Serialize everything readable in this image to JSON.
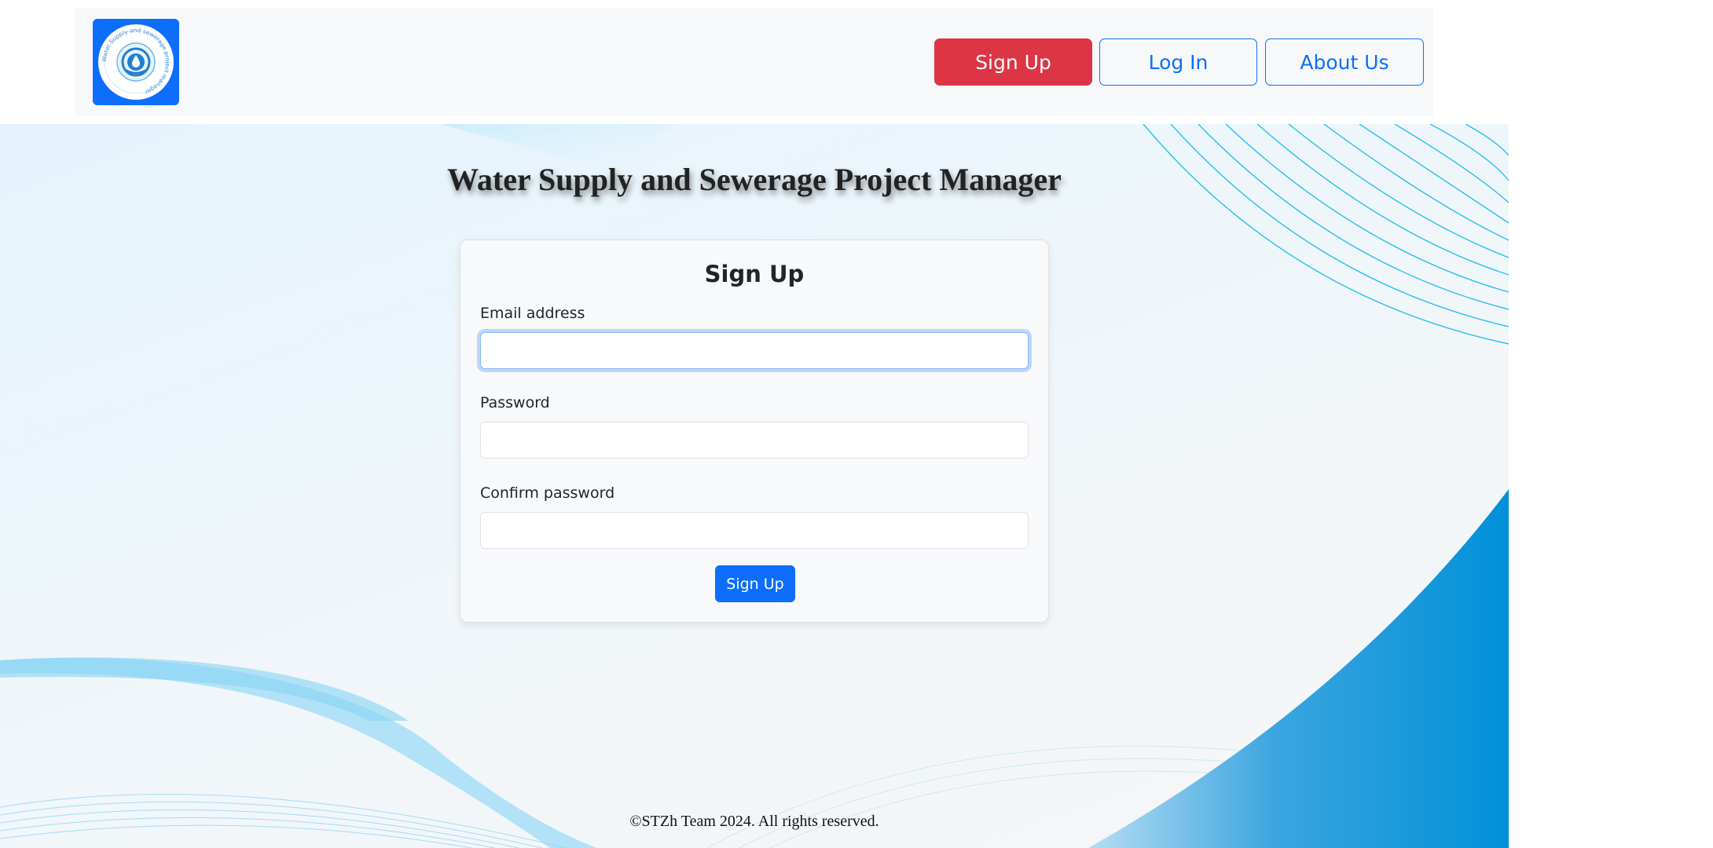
{
  "navbar": {
    "logo_text": "Water Supply and sewerage project manager",
    "signup_label": "Sign Up",
    "login_label": "Log In",
    "about_label": "About Us"
  },
  "main": {
    "title": "Water Supply and Sewerage Project Manager"
  },
  "form": {
    "title": "Sign Up",
    "email_label": "Email address",
    "email_value": "",
    "password_label": "Password",
    "password_value": "",
    "confirm_label": "Confirm password",
    "confirm_value": "",
    "submit_label": "Sign Up"
  },
  "footer": {
    "text": "©STZh Team 2024. All rights reserved."
  },
  "colors": {
    "primary": "#0d6efd",
    "danger": "#dc3545",
    "wave_blue": "#0090d9"
  }
}
